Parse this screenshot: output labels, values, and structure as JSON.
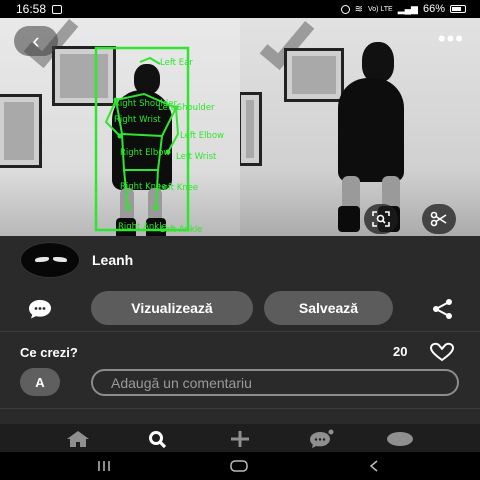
{
  "status_bar": {
    "time": "16:58",
    "network": "Vo) LTE",
    "battery": "66%"
  },
  "pose_labels": [
    "Left Ear",
    "Right Shoulder",
    "Left Shoulder",
    "Right Wrist",
    "Left Elbow",
    "Right Elbow",
    "Left Wrist",
    "Right Knee",
    "Left Knee",
    "Right Ankle",
    "Left Ankle"
  ],
  "overlay_color": "#2ee62e",
  "profile": {
    "username": "Leanh"
  },
  "actions": {
    "view_label": "Vizualizează",
    "save_label": "Salvează"
  },
  "comments": {
    "question": "Ce crezi?",
    "like_count": "20",
    "user_initial": "A",
    "input_placeholder": "Adaugă un comentariu"
  },
  "icons": {
    "back": "back-arrow-icon",
    "more": "more-dots-icon",
    "lens": "visual-search-icon",
    "scissors": "scissors-icon",
    "comment": "comment-bubble-icon",
    "share": "share-icon",
    "heart": "heart-icon",
    "nav": [
      "home-icon",
      "search-icon",
      "plus-icon",
      "messages-icon",
      "profile-icon"
    ]
  }
}
